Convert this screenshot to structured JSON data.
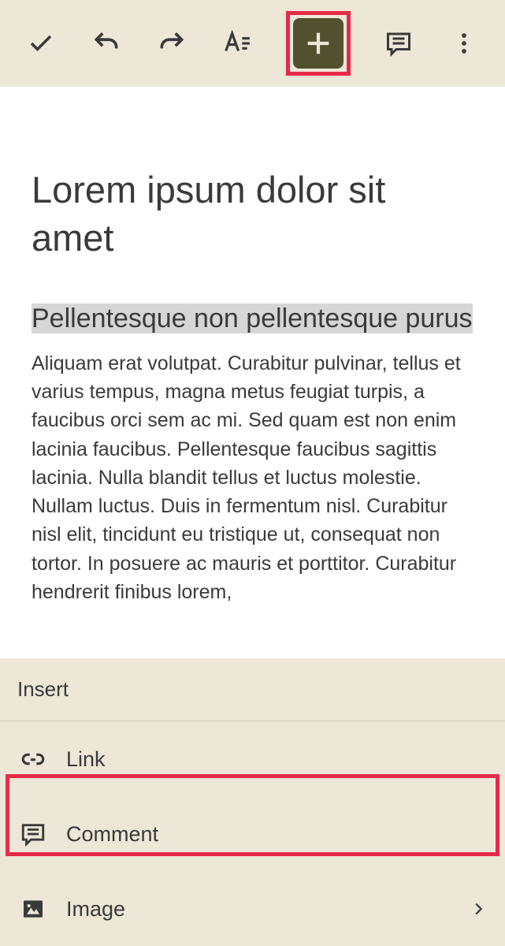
{
  "toolbar": {
    "confirm": "check",
    "undo": "undo",
    "redo": "redo",
    "format": "format",
    "add": "plus",
    "comment": "comment",
    "more": "more"
  },
  "document": {
    "title": "Lorem ipsum dolor sit amet",
    "heading": "Pellentesque non pellentesque purus",
    "body": "Aliquam erat volutpat. Curabitur pulvinar, tellus et varius tempus, magna metus feugiat turpis, a faucibus orci sem ac mi. Sed quam est non enim lacinia faucibus. Pellentesque faucibus sagittis lacinia. Nulla blandit tellus et luctus molestie. Nullam luctus. Duis in fermentum nisl. Curabitur nisl elit, tincidunt eu tristique ut, consequat non tortor. In posuere ac mauris et porttitor. Curabitur hendrerit finibus lorem,"
  },
  "sheet": {
    "title": "Insert",
    "items": [
      {
        "label": "Link",
        "icon": "link",
        "chevron": false
      },
      {
        "label": "Comment",
        "icon": "comment",
        "chevron": false
      },
      {
        "label": "Image",
        "icon": "image",
        "chevron": true
      }
    ]
  },
  "highlights": {
    "toolbar_add": true,
    "sheet_comment": true
  }
}
